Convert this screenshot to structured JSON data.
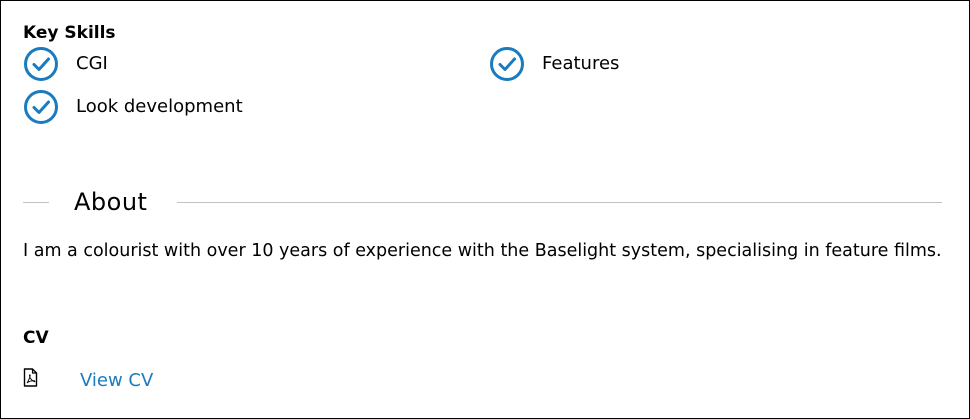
{
  "skills": {
    "heading": "Key Skills",
    "check_color": "#1a7bbf",
    "items": [
      {
        "label": "CGI",
        "icon": "check-circle-icon"
      },
      {
        "label": "Features",
        "icon": "check-circle-icon"
      },
      {
        "label": "Look development",
        "icon": "check-circle-icon"
      }
    ]
  },
  "about": {
    "title": "About",
    "text": "I am a colourist with over 10 years of experience with the Baselight system, specialising in feature films."
  },
  "cv": {
    "heading": "CV",
    "icon": "pdf-file-icon",
    "link_label": "View CV",
    "link_color": "#1a7bbf"
  }
}
